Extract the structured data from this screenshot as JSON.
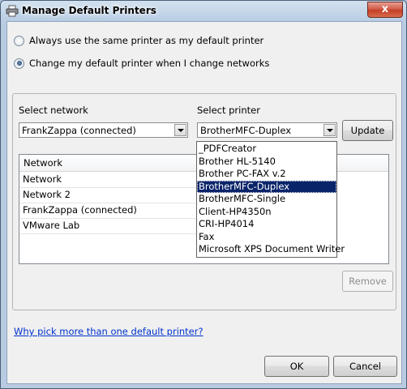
{
  "window": {
    "title": "Manage Default Printers",
    "close_glyph": "x"
  },
  "options": [
    {
      "label": "Always use the same printer as my default printer",
      "checked": false
    },
    {
      "label": "Change my default printer when I change networks",
      "checked": true
    }
  ],
  "network_select": {
    "label": "Select network",
    "value": "FrankZappa (connected)"
  },
  "printer_select": {
    "label": "Select printer",
    "value": "BrotherMFC-Duplex"
  },
  "update_button": "Update",
  "table": {
    "columns": [
      "Network",
      ""
    ],
    "rows": [
      "Network",
      "Network  2",
      "FrankZappa (connected)",
      "VMware Lab"
    ]
  },
  "printer_list": {
    "items": [
      "_PDFCreator",
      "Brother HL-5140",
      "Brother PC-FAX v.2",
      "BrotherMFC-Duplex",
      "BrotherMFC-Single",
      "Client-HP4350n",
      "CRI-HP4014",
      "Fax",
      "Microsoft XPS Document Writer"
    ],
    "selected_index": 3
  },
  "remove_button": "Remove",
  "help_link": "Why pick more than one default printer?",
  "ok_button": "OK",
  "cancel_button": "Cancel",
  "icons": {
    "title": "printer-icon"
  }
}
